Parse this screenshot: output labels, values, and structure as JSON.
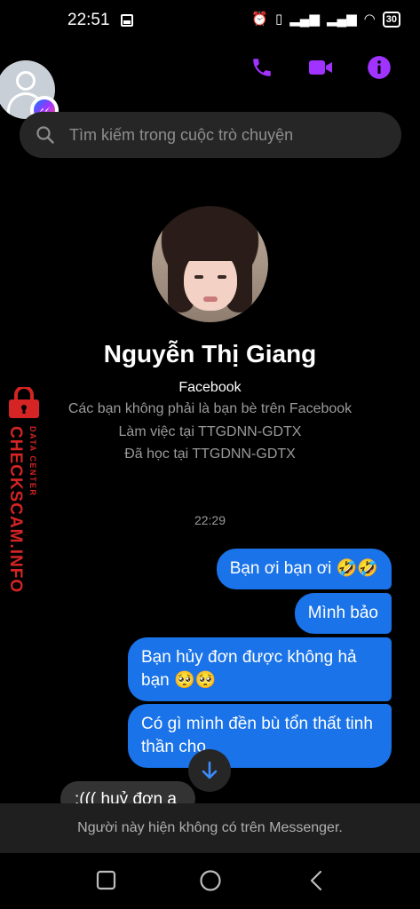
{
  "status_bar": {
    "time": "22:51",
    "battery": "30",
    "icons": [
      "image-icon",
      "alarm-icon",
      "vibrate-icon",
      "signal-icon",
      "signal-icon",
      "wifi-icon",
      "battery-icon"
    ]
  },
  "header": {
    "accent_color": "#a033ff",
    "actions": [
      "phone-call-icon",
      "video-call-icon",
      "info-icon"
    ]
  },
  "search": {
    "placeholder": "Tìm kiếm trong cuộc trò chuyện"
  },
  "profile": {
    "name": "Nguyễn Thị Giang",
    "subtitle": "Facebook",
    "info": [
      "Các bạn không phải là bạn bè trên Facebook",
      "Làm việc tại TTGDNN-GDTX",
      "Đã học tại TTGDNN-GDTX"
    ]
  },
  "watermark": {
    "brand": "CHECKSCAM.INFO",
    "sub": "DATA CENTER"
  },
  "conversation": {
    "timestamp": "22:29",
    "messages": [
      {
        "direction": "outgoing",
        "text": "Bạn ơi bạn ơi 🤣🤣"
      },
      {
        "direction": "outgoing",
        "text": "Mình bảo"
      },
      {
        "direction": "outgoing",
        "text": "Bạn hủy đơn được không hả bạn 🥺🥺"
      },
      {
        "direction": "outgoing",
        "text": "Có gì mình đền bù tổn thất tinh thần cho"
      },
      {
        "direction": "incoming",
        "text": ":((( huỷ đơn a"
      }
    ]
  },
  "notice": {
    "text": "Người này hiện không có trên Messenger."
  },
  "colors": {
    "bubble_outgoing": "#1a73e8",
    "bubble_incoming": "#333333",
    "watermark_red": "#d42424"
  }
}
